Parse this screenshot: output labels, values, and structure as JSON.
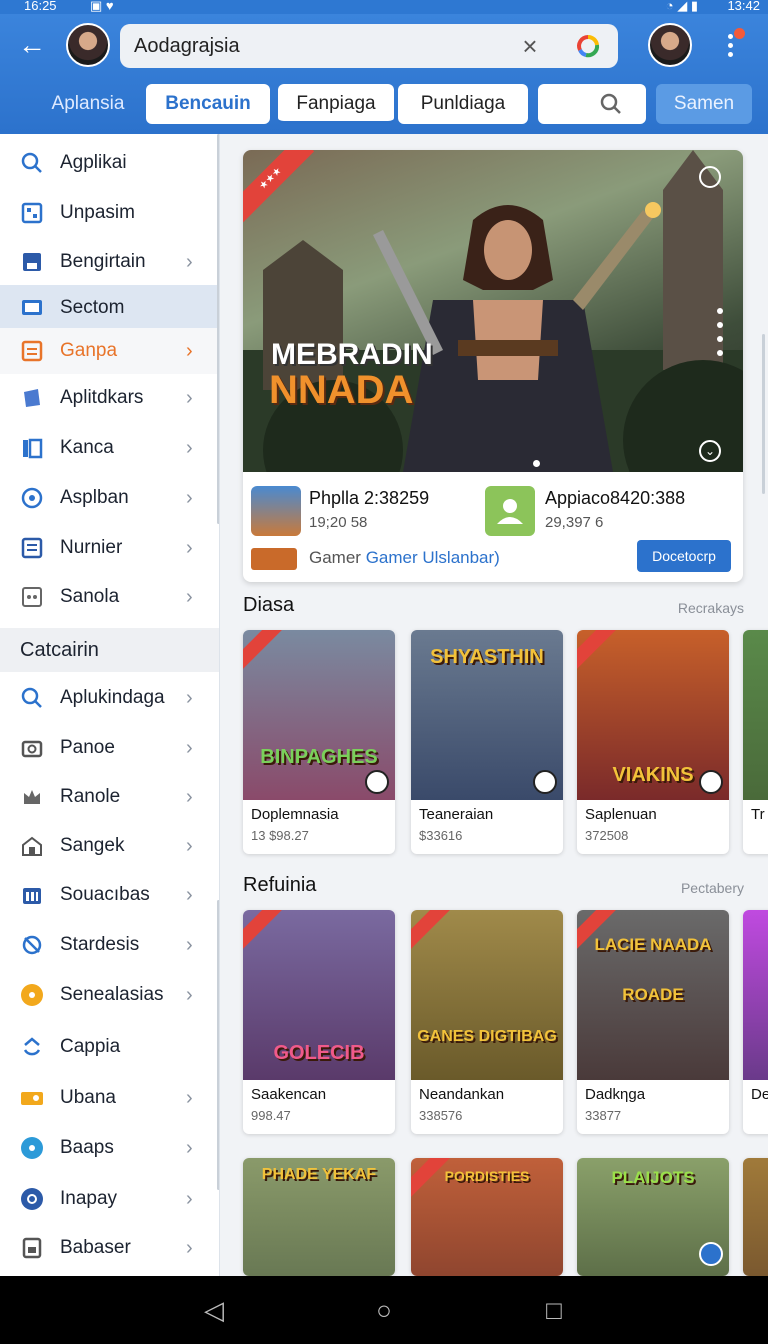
{
  "status_bar": {
    "time": "16:25",
    "right_time": "13:42"
  },
  "header": {
    "search_value": "Aоdagrajsia",
    "tabs": [
      {
        "label": "Aplansia"
      },
      {
        "label": "Bencauin"
      },
      {
        "label": "Fanpiaga"
      },
      {
        "label": "Punldiaga"
      },
      {
        "label": ""
      },
      {
        "label": "Samen"
      }
    ]
  },
  "sidebar": {
    "items": [
      {
        "label": "Agplikai",
        "icon": "search-icon"
      },
      {
        "label": "Unpasim",
        "icon": "grid-icon"
      },
      {
        "label": "Bengirtain",
        "icon": "save-icon"
      },
      {
        "label": "Sectom",
        "icon": "monitor-icon"
      },
      {
        "label": "Ganpa",
        "icon": "list-icon"
      },
      {
        "label": "Aplitdkars",
        "icon": "book-icon"
      },
      {
        "label": "Kanca",
        "icon": "pages-icon"
      },
      {
        "label": "Asplban",
        "icon": "target-icon"
      },
      {
        "label": "Nurnier",
        "icon": "doc-icon"
      },
      {
        "label": "Sanola",
        "icon": "dots-icon"
      }
    ],
    "category_header": "Catcairin",
    "category_items": [
      {
        "label": "Aplukindaga",
        "icon": "search-icon"
      },
      {
        "label": "Panoe",
        "icon": "camera-icon"
      },
      {
        "label": "Ranole",
        "icon": "crown-icon"
      },
      {
        "label": "Sangek",
        "icon": "house-icon"
      },
      {
        "label": "Souacıbas",
        "icon": "calendar-icon"
      },
      {
        "label": "Stardesis",
        "icon": "compass-icon"
      },
      {
        "label": "Senealasias",
        "icon": "coin-icon"
      },
      {
        "label": "Cappia",
        "icon": "refresh-icon"
      },
      {
        "label": "Ubana",
        "icon": "ticket-icon"
      },
      {
        "label": "Baaps",
        "icon": "circle-icon"
      },
      {
        "label": "Inapay",
        "icon": "pay-icon"
      },
      {
        "label": "Babaser",
        "icon": "box-icon"
      }
    ]
  },
  "hero": {
    "title_line1": "MEBRADIN",
    "title_line2": "NNADA",
    "app1_name": "Phplla 2:38259",
    "app1_sub": "19;20 58",
    "app2_name": "Appiaco8420:388",
    "app2_sub": "29,397 6",
    "gamer_prefix": "Gamer ",
    "gamer_link": "Gamer Ulslanbar)",
    "download_label": "Docetocrp"
  },
  "sections": [
    {
      "title": "Diasa",
      "more": "Recrakays",
      "games": [
        {
          "thumb_text": "BINPAGHES",
          "name": "Doplemnasia",
          "price": "13 $98.27",
          "color": "#8a4a6a"
        },
        {
          "thumb_text": "SHYASTHIN",
          "name": "Teaneraian",
          "price": "$33616",
          "color": "#3a4a6a"
        },
        {
          "thumb_text": "VIAKINS",
          "name": "Saplenuan",
          "price": "372508",
          "color": "#7a2a2a"
        },
        {
          "thumb_text": "",
          "name": "Tr",
          "price": "",
          "color": "#4a6a3a"
        }
      ]
    },
    {
      "title": "Refuinia",
      "more": "Pectabery",
      "games": [
        {
          "thumb_text": "GOLECIB",
          "name": "Saakencan",
          "price": "998.47",
          "color": "#5a3a6a"
        },
        {
          "thumb_text": "GANES DIGTIBAG",
          "name": "Neandankan",
          "price": "338576",
          "color": "#6a5a2a"
        },
        {
          "thumb_text": "LACIE NAADA ROADE",
          "name": "Dadkηga",
          "price": "33877",
          "color": "#4a3a3a"
        },
        {
          "thumb_text": "",
          "name": "De",
          "price": "",
          "color": "#6a3a8a"
        }
      ]
    },
    {
      "games": [
        {
          "thumb_text": "PHADE YEKAF",
          "color": "#5a6a4a"
        },
        {
          "thumb_text": "PORDISTIES",
          "color": "#7a3a2a"
        },
        {
          "thumb_text": "PLAIJOTS",
          "color": "#4a5a3a"
        },
        {
          "thumb_text": "",
          "color": "#6a4a2a"
        }
      ]
    }
  ],
  "colors": {
    "accent": "#2c72cc",
    "highlight": "#e8742a",
    "ribbon": "#e2433a"
  }
}
